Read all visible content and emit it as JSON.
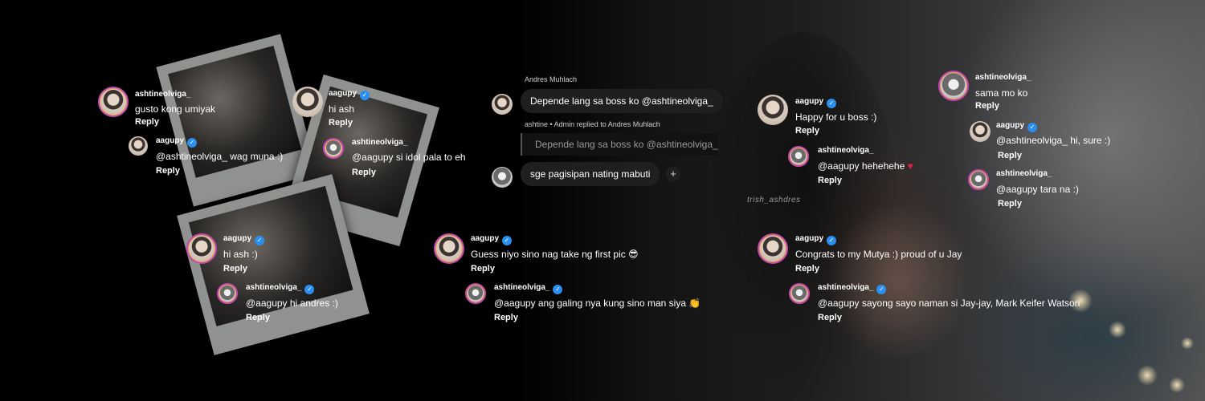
{
  "watermark": "trish_ashdres",
  "icons": {
    "verified": "verified-check-icon",
    "plus": "plus-icon",
    "heart": "heart-emoji",
    "sunglasses": "sunglasses-emoji",
    "clap": "clapping-hands-emoji"
  },
  "colors": {
    "verified": "#2b8ff0",
    "heart": "#e11d48",
    "story_ring": "#c04bb0"
  },
  "left_threads": [
    {
      "user": "ashtineolviga_",
      "text": "gusto kong umiyak",
      "reply": "Reply"
    },
    {
      "user": "aagupy",
      "text": "@ashtineolviga_ wag muna :)",
      "reply": "Reply"
    },
    {
      "user": "aagupy",
      "text": "hi ash",
      "reply": "Reply"
    },
    {
      "user": "ashtineolviga_",
      "text": "@aagupy si idol pala to eh",
      "reply": "Reply"
    },
    {
      "user": "aagupy",
      "text": "hi ash :)",
      "reply": "Reply"
    },
    {
      "user": "ashtineolviga_",
      "text": "@aagupy hi andres :)",
      "reply": "Reply"
    }
  ],
  "chat": {
    "sender_name": "Andres Muhlach",
    "message": "Depende lang sa boss ko @ashtineolviga_",
    "replied_meta": "ashtine • Admin replied to Andres Muhlach",
    "quoted": "Depende lang sa boss ko @ashtineolviga_",
    "reply_message": "sge pagisipan nating mabuti",
    "plus": "+"
  },
  "middle_threads": [
    {
      "user": "aagupy",
      "text": "Guess niyo sino nag take ng first pic",
      "emoji": "😎",
      "reply": "Reply"
    },
    {
      "user": "ashtineolviga_",
      "text": "@aagupy ang galing nya kung sino man siya",
      "emoji": "👏",
      "reply": "Reply"
    }
  ],
  "right_threads": [
    {
      "user": "aagupy",
      "text": "Happy for u boss :)",
      "reply": "Reply"
    },
    {
      "user": "ashtineolviga_",
      "text": "@aagupy hehehehe",
      "emoji": "♥",
      "reply": "Reply"
    },
    {
      "user": "aagupy",
      "text": "Congrats to my Mutya :) proud of u Jay",
      "reply": "Reply"
    },
    {
      "user": "ashtineolviga_",
      "text": "@aagupy sayong sayo naman si Jay-jay, Mark Keifer Watson",
      "reply": "Reply"
    }
  ],
  "far_right_threads": [
    {
      "user": "ashtineolviga_",
      "text": "sama mo ko",
      "reply": "Reply"
    },
    {
      "user": "aagupy",
      "text": "@ashtineolviga_ hi, sure :)",
      "reply": "Reply"
    },
    {
      "user": "ashtineolviga_",
      "text": "@aagupy tara na :)",
      "reply": "Reply"
    }
  ]
}
